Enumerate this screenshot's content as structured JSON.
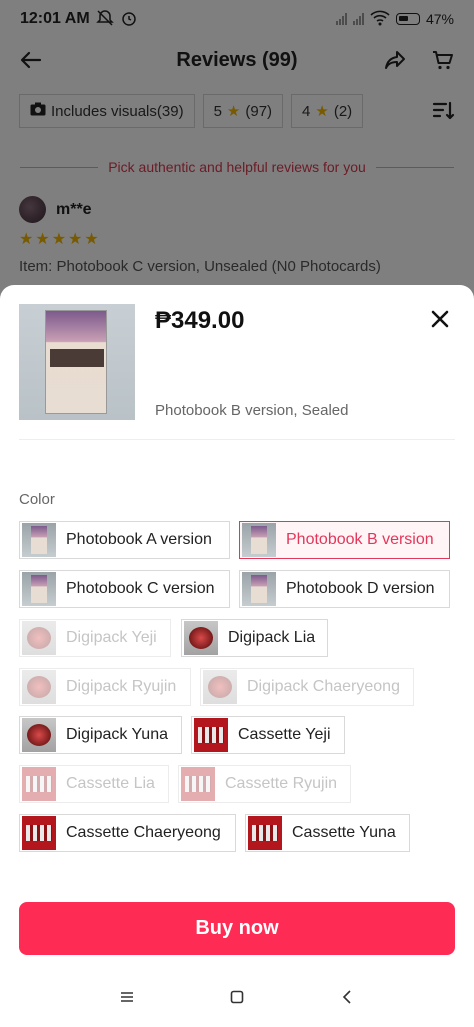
{
  "status_bar": {
    "time": "12:01 AM",
    "battery": "47%"
  },
  "header": {
    "title": "Reviews (99)"
  },
  "filters": [
    {
      "label": "Includes visuals(39)",
      "icon": "camera-icon"
    },
    {
      "label_num": "5",
      "count": "(97)"
    },
    {
      "label_num": "4",
      "count": "(2)"
    }
  ],
  "notice": "Pick authentic and helpful reviews for you",
  "review": {
    "reviewer": "m**e",
    "stars": "★★★★★",
    "item": "Item: Photobook C version, Unsealed (N0 Photocards)"
  },
  "sheet": {
    "price": "₱349.00",
    "selected_variant": "Photobook B version, Sealed",
    "color_label": "Color",
    "options": [
      {
        "label": "Photobook A version",
        "state": "normal"
      },
      {
        "label": "Photobook B version",
        "state": "selected"
      },
      {
        "label": "Photobook C version",
        "state": "normal"
      },
      {
        "label": "Photobook D version",
        "state": "normal"
      },
      {
        "label": "Digipack Yeji",
        "state": "disabled"
      },
      {
        "label": "Digipack Lia",
        "state": "normal"
      },
      {
        "label": "Digipack Ryujin",
        "state": "disabled"
      },
      {
        "label": "Digipack Chaeryeong",
        "state": "disabled"
      },
      {
        "label": "Digipack Yuna",
        "state": "normal"
      },
      {
        "label": "Cassette Yeji",
        "state": "normal"
      },
      {
        "label": "Cassette Lia",
        "state": "disabled"
      },
      {
        "label": "Cassette Ryujin",
        "state": "disabled"
      },
      {
        "label": "Cassette Chaeryeong",
        "state": "normal"
      },
      {
        "label": "Cassette Yuna",
        "state": "normal"
      }
    ],
    "buy_label": "Buy now"
  },
  "colors": {
    "accent": "#fe2c55",
    "selected": "#e3375a",
    "star": "#f0b400"
  }
}
